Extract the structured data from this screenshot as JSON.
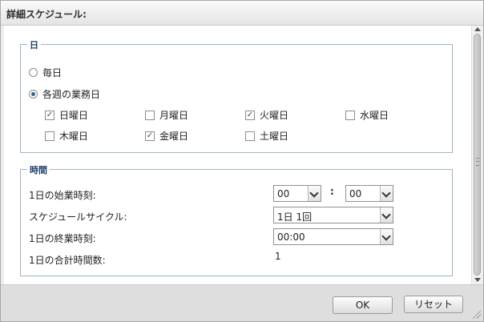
{
  "window": {
    "title": "詳細スケジュール:"
  },
  "day_group": {
    "legend": "日",
    "radio_every_day": {
      "label": "毎日",
      "checked": false
    },
    "radio_weekly": {
      "label": "各週の業務日",
      "checked": true
    },
    "days": [
      {
        "label": "日曜日",
        "checked": true
      },
      {
        "label": "月曜日",
        "checked": false
      },
      {
        "label": "火曜日",
        "checked": true
      },
      {
        "label": "水曜日",
        "checked": false
      },
      {
        "label": "木曜日",
        "checked": false
      },
      {
        "label": "金曜日",
        "checked": true
      },
      {
        "label": "土曜日",
        "checked": false
      }
    ]
  },
  "time_group": {
    "legend": "時間",
    "start_time_label": "1日の始業時刻:",
    "start_hour": "00",
    "time_separator": ":",
    "start_minute": "00",
    "cycle_label": "スケジュールサイクル:",
    "cycle_value": "1日 1回",
    "end_time_label": "1日の終業時刻:",
    "end_time_value": "00:00",
    "total_hours_label": "1日の合計時間数:",
    "total_hours_value": "1"
  },
  "footer": {
    "ok_label": "OK",
    "reset_label": "リセット"
  }
}
